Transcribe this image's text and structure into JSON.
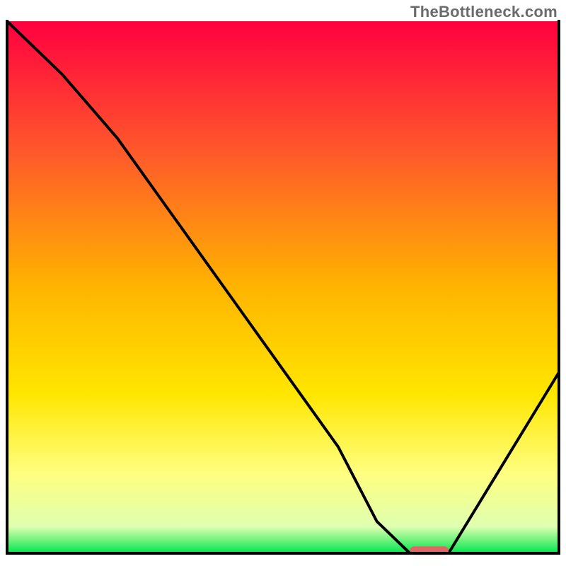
{
  "watermark": "TheBottleneck.com",
  "chart_data": {
    "type": "line",
    "title": "",
    "xlabel": "",
    "ylabel": "",
    "xlim": [
      0,
      100
    ],
    "ylim": [
      0,
      100
    ],
    "x": [
      0,
      10,
      20,
      30,
      40,
      50,
      60,
      67,
      73,
      80,
      90,
      100
    ],
    "values": [
      100,
      90,
      78,
      63.5,
      49,
      34.5,
      20,
      6,
      0,
      0,
      17,
      34
    ],
    "marker": {
      "x_start": 73,
      "x_end": 80,
      "y": 0.5,
      "color": "#e06666"
    },
    "gradient_stops": [
      {
        "pct": 0,
        "color": "#ff0040"
      },
      {
        "pct": 25,
        "color": "#ff5a2a"
      },
      {
        "pct": 50,
        "color": "#ffb400"
      },
      {
        "pct": 70,
        "color": "#ffe600"
      },
      {
        "pct": 85,
        "color": "#ffff80"
      },
      {
        "pct": 95,
        "color": "#dfffb0"
      },
      {
        "pct": 100,
        "color": "#00e64d"
      }
    ],
    "frame": {
      "margin_top": 30,
      "margin_left": 10,
      "margin_right": 10,
      "margin_bottom": 18,
      "line_color": "#000000",
      "line_width": 4
    }
  }
}
